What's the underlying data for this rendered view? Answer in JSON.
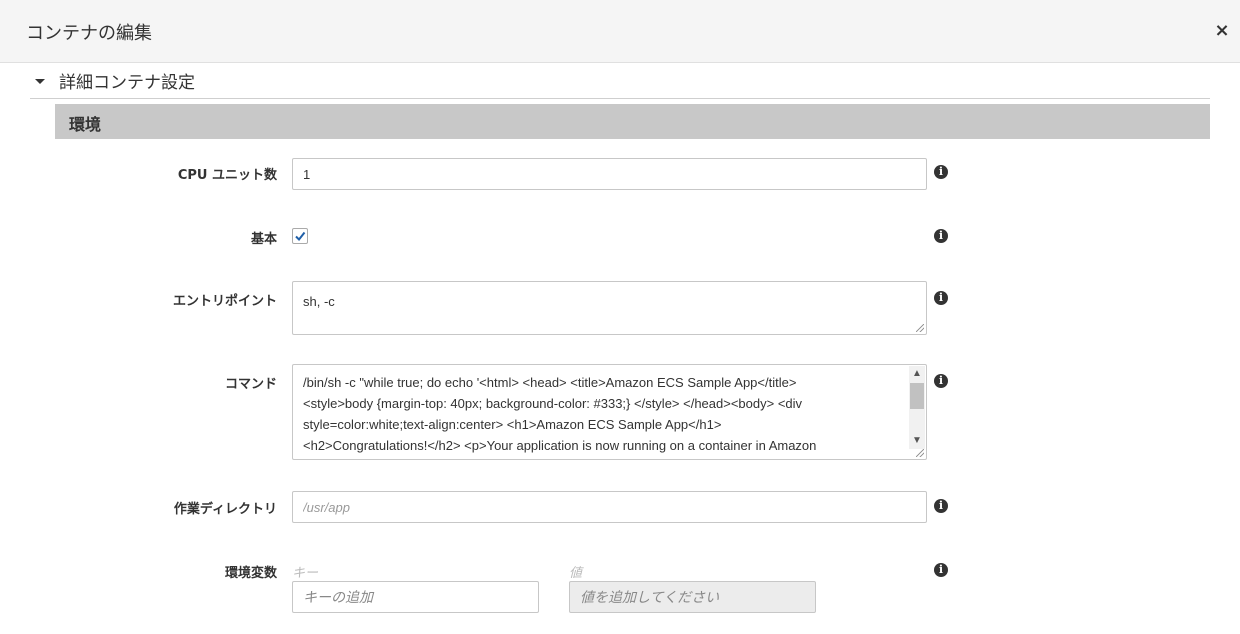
{
  "modal": {
    "title": "コンテナの編集",
    "close_icon": "×"
  },
  "section": {
    "title": "詳細コンテナ設定"
  },
  "subsection": {
    "title": "環境"
  },
  "fields": {
    "cpu": {
      "label": "CPU ユニット数",
      "value": "1"
    },
    "essential": {
      "label": "基本",
      "checked": true
    },
    "entrypoint": {
      "label": "エントリポイント",
      "value": "sh, -c"
    },
    "command": {
      "label": "コマンド",
      "lines": [
        "/bin/sh -c \"while true; do echo '<html> <head> <title>Amazon ECS Sample App</title>",
        "<style>body {margin-top: 40px; background-color: #333;} </style> </head><body> <div",
        "style=color:white;text-align:center> <h1>Amazon ECS Sample App</h1>",
        "<h2>Congratulations!</h2> <p>Your application is now running on a container in Amazon"
      ]
    },
    "workdir": {
      "label": "作業ディレクトリ",
      "placeholder": "/usr/app"
    },
    "envvars": {
      "label": "環境変数",
      "key_header": "キー",
      "value_header": "値",
      "key_placeholder": "キーの追加",
      "value_placeholder": "値を追加してください"
    }
  },
  "info_icon_glyph": "i",
  "scroll": {
    "up": "▲",
    "down": "▼"
  }
}
